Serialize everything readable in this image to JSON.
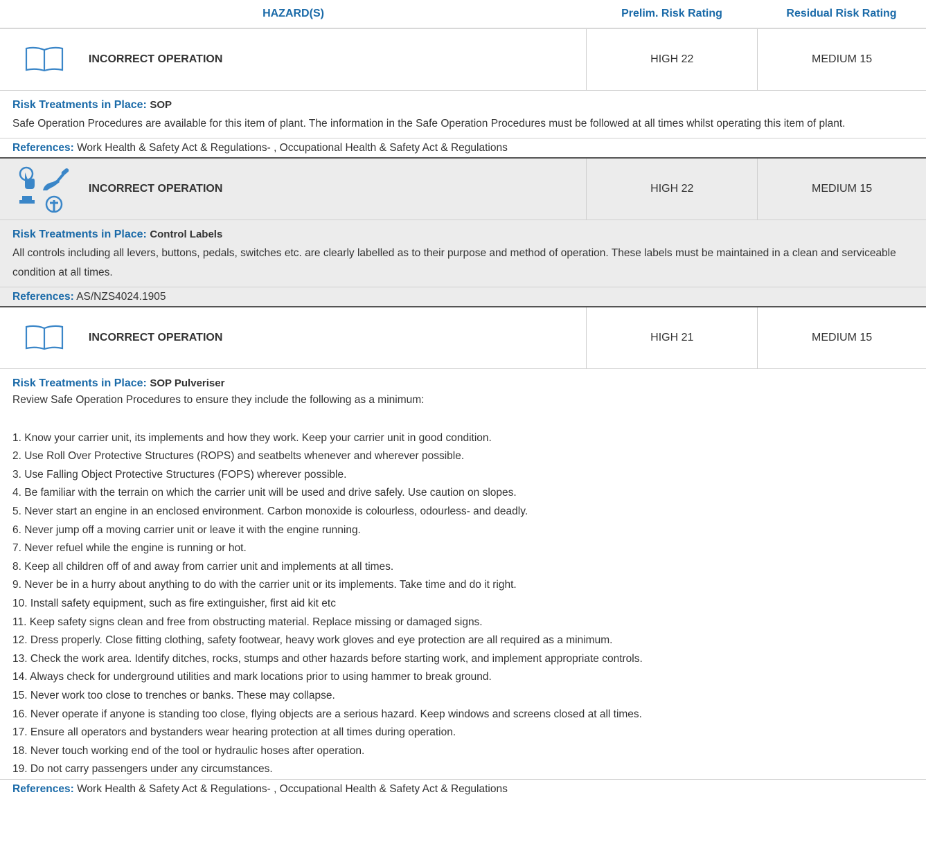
{
  "header": {
    "hazard": "HAZARD(S)",
    "prelim": "Prelim. Risk Rating",
    "residual": "Residual Risk Rating"
  },
  "labels": {
    "treatments": "Risk Treatments in Place:",
    "references": "References:"
  },
  "colors": {
    "accent": "#1a6aa8",
    "grey_band": "#ececec",
    "icon_blue": "#3a86c8"
  },
  "hazards": [
    {
      "icon": "book-icon",
      "name": "INCORRECT OPERATION",
      "prelim": "HIGH 22",
      "residual": "MEDIUM 15",
      "treatment_name": "SOP",
      "treatment_text": "Safe Operation Procedures are available for this item of plant. The information in the Safe Operation Procedures must be followed at all times whilst operating this item of plant.",
      "references": "Work Health & Safety Act & Regulations- , Occupational Health & Safety Act & Regulations"
    },
    {
      "icon": "controls-icon",
      "name": "INCORRECT OPERATION",
      "prelim": "HIGH 22",
      "residual": "MEDIUM 15",
      "treatment_name": "Control Labels",
      "treatment_text": "All controls including all levers, buttons, pedals, switches etc. are clearly labelled as to their purpose and method of operation. These labels must be maintained in a clean and serviceable condition at all times.",
      "references": "AS/NZS4024.1905"
    },
    {
      "icon": "book-icon",
      "name": "INCORRECT OPERATION",
      "prelim": "HIGH 21",
      "residual": "MEDIUM 15",
      "treatment_name": "SOP Pulveriser",
      "treatment_intro": "Review Safe Operation Procedures to ensure they include the following as a minimum:",
      "treatment_items": [
        "1. Know your carrier unit, its implements and how they work. Keep your carrier unit in good condition.",
        "2. Use Roll Over Protective Structures (ROPS) and seatbelts whenever and wherever possible.",
        "3. Use Falling Object Protective Structures (FOPS) wherever possible.",
        "4. Be familiar with the terrain on which the carrier unit will be used and drive safely. Use caution on slopes.",
        "5. Never start an engine in an enclosed environment. Carbon monoxide is colourless, odourless- and deadly.",
        "6. Never jump off a moving carrier unit or leave it with the engine running.",
        "7. Never refuel while the engine is running or hot.",
        "8. Keep all children off of and away from carrier unit and implements at all times.",
        "9. Never be in a hurry about anything to do with the carrier unit or its implements. Take time and do it right.",
        "10. Install safety equipment, such as fire extinguisher, first aid kit etc",
        "11. Keep safety signs clean and free from obstructing material. Replace missing or damaged signs.",
        "12. Dress properly. Close fitting clothing, safety footwear, heavy work gloves and eye protection are all required as a minimum.",
        "13. Check the work area. Identify ditches, rocks, stumps and other hazards before starting work, and implement appropriate controls.",
        "14. Always check for underground utilities and mark locations prior to using hammer to break ground.",
        "15. Never work too close to trenches or banks. These may collapse.",
        "16. Never operate if anyone is standing too close, flying objects are a serious hazard. Keep windows and screens closed at all times.",
        "17. Ensure all operators and bystanders wear hearing protection at all times during operation.",
        "18. Never touch working end of the tool or hydraulic hoses after operation.",
        "19. Do not carry passengers under any circumstances."
      ],
      "references": "Work Health & Safety Act & Regulations- , Occupational Health & Safety Act & Regulations"
    }
  ]
}
